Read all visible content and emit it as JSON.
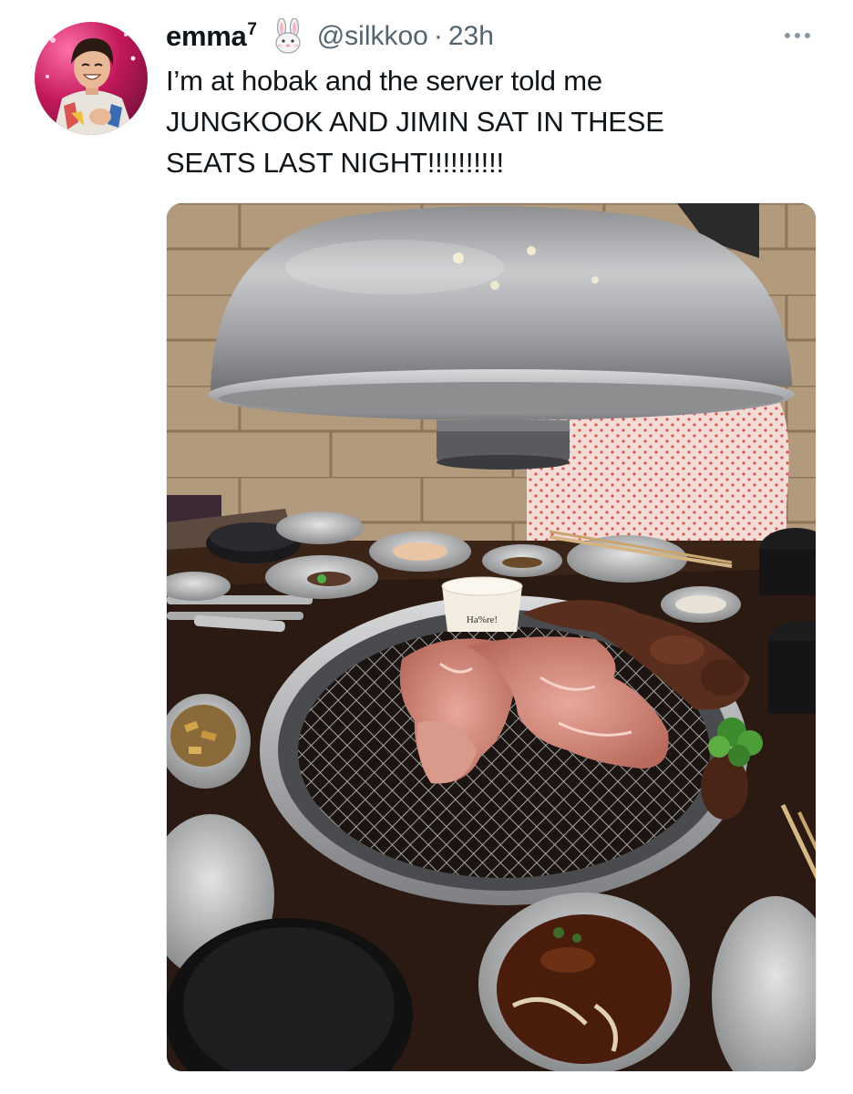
{
  "user": {
    "display_name": "emma",
    "name_superscript": "7",
    "emoji_icon": "rabbit-face-icon",
    "handle": "@silkkoo",
    "separator": "·",
    "time": "23h"
  },
  "menu": {
    "icon": "more-dots-icon"
  },
  "tweet": {
    "lines": [
      "I’m at hobak and the server told me",
      "JUNGKOOK AND JIMIN SAT IN THESE",
      "SEATS LAST NIGHT!!!!!!!!!!"
    ]
  },
  "photo": {
    "sauce_cup_label": "Ha%re!"
  },
  "colors": {
    "text": "#0f1419",
    "secondary": "#536471",
    "avatar_bg": "#c2185b"
  }
}
